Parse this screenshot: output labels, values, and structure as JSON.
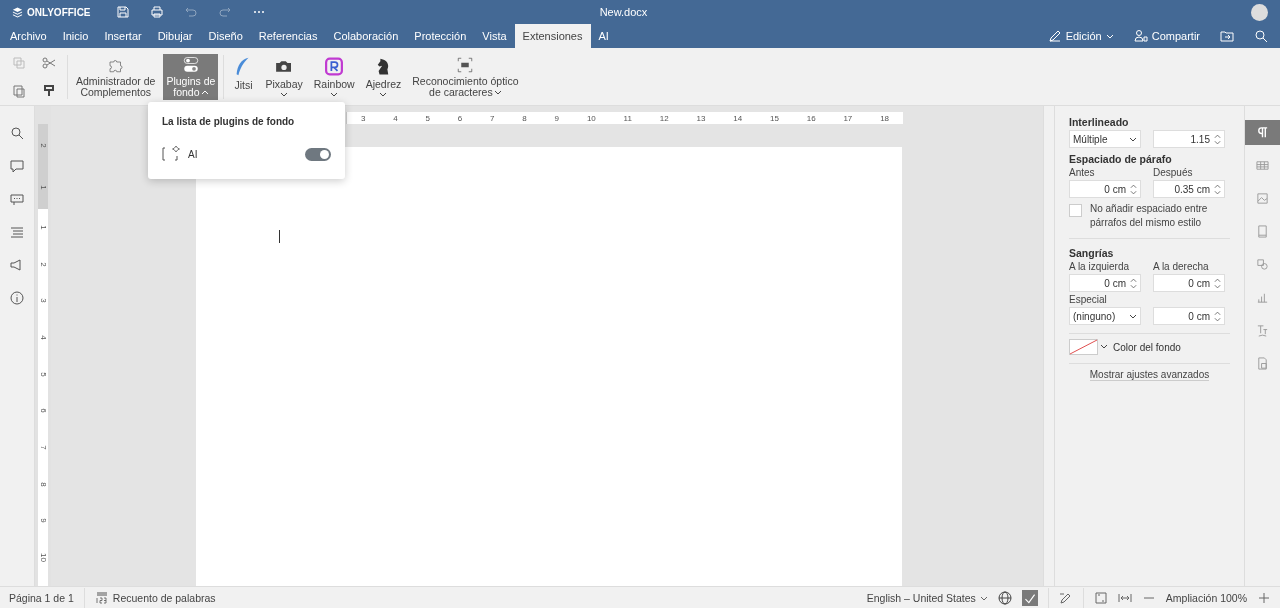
{
  "app": {
    "logo": "ONLYOFFICE",
    "title": "New.docx"
  },
  "tabs": [
    {
      "label": "Archivo",
      "selected": false
    },
    {
      "label": "Inicio",
      "selected": false
    },
    {
      "label": "Insertar",
      "selected": false
    },
    {
      "label": "Dibujar",
      "selected": false
    },
    {
      "label": "Diseño",
      "selected": false
    },
    {
      "label": "Referencias",
      "selected": false
    },
    {
      "label": "Colaboración",
      "selected": false
    },
    {
      "label": "Protección",
      "selected": false
    },
    {
      "label": "Vista",
      "selected": false
    },
    {
      "label": "Extensiones",
      "selected": true
    },
    {
      "label": "AI",
      "selected": false
    }
  ],
  "header_actions": {
    "mode": "Edición",
    "share": "Compartir"
  },
  "plugins": [
    {
      "kind": "puzzle",
      "lines": [
        "Administrador de",
        "Complementos"
      ],
      "caret": false,
      "selected": false
    },
    {
      "kind": "toggle",
      "lines": [
        "Plugins de",
        "fondo"
      ],
      "caret": true,
      "selected": true
    },
    {
      "kind": "feather",
      "lines": [
        "Jitsi"
      ],
      "caret": false,
      "selected": false
    },
    {
      "kind": "camera",
      "lines": [
        "Pixabay"
      ],
      "caret": true,
      "selected": false
    },
    {
      "kind": "rainbow",
      "lines": [
        "Rainbow"
      ],
      "caret": true,
      "selected": false
    },
    {
      "kind": "knight",
      "lines": [
        "Ajedrez"
      ],
      "caret": true,
      "selected": false
    },
    {
      "kind": "ocr",
      "lines": [
        "Reconocimiento óptico",
        "de caracteres"
      ],
      "caret": true,
      "selected": false
    }
  ],
  "popup": {
    "title": "La lista de plugins de fondo",
    "items": [
      {
        "label": "AI",
        "on": true
      }
    ]
  },
  "ruler": {
    "h_labels": [
      "3",
      "4",
      "5",
      "6",
      "7",
      "8",
      "9",
      "10",
      "11",
      "12",
      "13",
      "14",
      "15",
      "16",
      "17",
      "18"
    ],
    "v_labels": [
      "2",
      "1",
      "1",
      "2",
      "3",
      "4",
      "5",
      "6",
      "7",
      "8",
      "9",
      "10"
    ]
  },
  "paragraph": {
    "line_spacing_title": "Interlineado",
    "line_spacing_type": "Múltiple",
    "line_spacing_value": "1.15",
    "spacing_title": "Espaciado de párafo",
    "before_label": "Antes",
    "before": "0 cm",
    "after_label": "Después",
    "after": "0.35 cm",
    "no_space": {
      "label": "No añadir espaciado entre párrafos del mismo estilo",
      "checked": false
    },
    "indent_title": "Sangrías",
    "left_label": "A la izquierda",
    "left": "0 cm",
    "right_label": "A la derecha",
    "right": "0 cm",
    "special_label": "Especial",
    "special": "(ninguno)",
    "special_value": "0 cm",
    "background_label": "Color del fondo",
    "advanced": "Mostrar ajustes avanzados"
  },
  "side_tabs": [
    {
      "kind": "paragraph",
      "selected": true
    },
    {
      "kind": "table",
      "selected": false
    },
    {
      "kind": "image",
      "selected": false
    },
    {
      "kind": "header",
      "selected": false
    },
    {
      "kind": "shape",
      "selected": false
    },
    {
      "kind": "chart",
      "selected": false
    },
    {
      "kind": "textart",
      "selected": false
    },
    {
      "kind": "form",
      "selected": false
    }
  ],
  "status_bar": {
    "page": "Página 1 de 1",
    "word_count": "Recuento de palabras",
    "language": "English – United States",
    "zoom": "Ampliación 100%"
  }
}
